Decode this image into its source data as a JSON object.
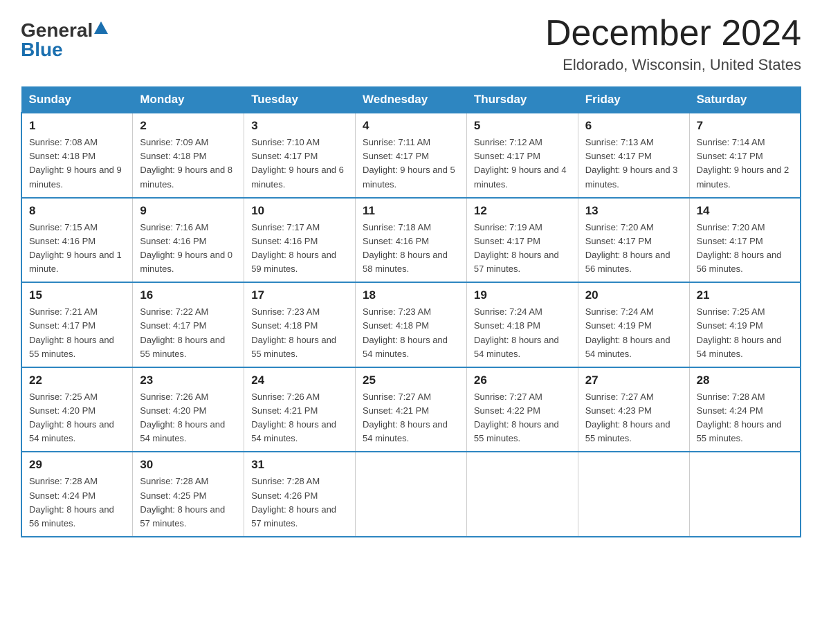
{
  "header": {
    "logo": {
      "general": "General",
      "blue": "Blue",
      "aria": "GeneralBlue logo"
    },
    "title": "December 2024",
    "location": "Eldorado, Wisconsin, United States"
  },
  "days_of_week": [
    "Sunday",
    "Monday",
    "Tuesday",
    "Wednesday",
    "Thursday",
    "Friday",
    "Saturday"
  ],
  "weeks": [
    [
      {
        "day": "1",
        "sunrise": "7:08 AM",
        "sunset": "4:18 PM",
        "daylight": "9 hours and 9 minutes."
      },
      {
        "day": "2",
        "sunrise": "7:09 AM",
        "sunset": "4:18 PM",
        "daylight": "9 hours and 8 minutes."
      },
      {
        "day": "3",
        "sunrise": "7:10 AM",
        "sunset": "4:17 PM",
        "daylight": "9 hours and 6 minutes."
      },
      {
        "day": "4",
        "sunrise": "7:11 AM",
        "sunset": "4:17 PM",
        "daylight": "9 hours and 5 minutes."
      },
      {
        "day": "5",
        "sunrise": "7:12 AM",
        "sunset": "4:17 PM",
        "daylight": "9 hours and 4 minutes."
      },
      {
        "day": "6",
        "sunrise": "7:13 AM",
        "sunset": "4:17 PM",
        "daylight": "9 hours and 3 minutes."
      },
      {
        "day": "7",
        "sunrise": "7:14 AM",
        "sunset": "4:17 PM",
        "daylight": "9 hours and 2 minutes."
      }
    ],
    [
      {
        "day": "8",
        "sunrise": "7:15 AM",
        "sunset": "4:16 PM",
        "daylight": "9 hours and 1 minute."
      },
      {
        "day": "9",
        "sunrise": "7:16 AM",
        "sunset": "4:16 PM",
        "daylight": "9 hours and 0 minutes."
      },
      {
        "day": "10",
        "sunrise": "7:17 AM",
        "sunset": "4:16 PM",
        "daylight": "8 hours and 59 minutes."
      },
      {
        "day": "11",
        "sunrise": "7:18 AM",
        "sunset": "4:16 PM",
        "daylight": "8 hours and 58 minutes."
      },
      {
        "day": "12",
        "sunrise": "7:19 AM",
        "sunset": "4:17 PM",
        "daylight": "8 hours and 57 minutes."
      },
      {
        "day": "13",
        "sunrise": "7:20 AM",
        "sunset": "4:17 PM",
        "daylight": "8 hours and 56 minutes."
      },
      {
        "day": "14",
        "sunrise": "7:20 AM",
        "sunset": "4:17 PM",
        "daylight": "8 hours and 56 minutes."
      }
    ],
    [
      {
        "day": "15",
        "sunrise": "7:21 AM",
        "sunset": "4:17 PM",
        "daylight": "8 hours and 55 minutes."
      },
      {
        "day": "16",
        "sunrise": "7:22 AM",
        "sunset": "4:17 PM",
        "daylight": "8 hours and 55 minutes."
      },
      {
        "day": "17",
        "sunrise": "7:23 AM",
        "sunset": "4:18 PM",
        "daylight": "8 hours and 55 minutes."
      },
      {
        "day": "18",
        "sunrise": "7:23 AM",
        "sunset": "4:18 PM",
        "daylight": "8 hours and 54 minutes."
      },
      {
        "day": "19",
        "sunrise": "7:24 AM",
        "sunset": "4:18 PM",
        "daylight": "8 hours and 54 minutes."
      },
      {
        "day": "20",
        "sunrise": "7:24 AM",
        "sunset": "4:19 PM",
        "daylight": "8 hours and 54 minutes."
      },
      {
        "day": "21",
        "sunrise": "7:25 AM",
        "sunset": "4:19 PM",
        "daylight": "8 hours and 54 minutes."
      }
    ],
    [
      {
        "day": "22",
        "sunrise": "7:25 AM",
        "sunset": "4:20 PM",
        "daylight": "8 hours and 54 minutes."
      },
      {
        "day": "23",
        "sunrise": "7:26 AM",
        "sunset": "4:20 PM",
        "daylight": "8 hours and 54 minutes."
      },
      {
        "day": "24",
        "sunrise": "7:26 AM",
        "sunset": "4:21 PM",
        "daylight": "8 hours and 54 minutes."
      },
      {
        "day": "25",
        "sunrise": "7:27 AM",
        "sunset": "4:21 PM",
        "daylight": "8 hours and 54 minutes."
      },
      {
        "day": "26",
        "sunrise": "7:27 AM",
        "sunset": "4:22 PM",
        "daylight": "8 hours and 55 minutes."
      },
      {
        "day": "27",
        "sunrise": "7:27 AM",
        "sunset": "4:23 PM",
        "daylight": "8 hours and 55 minutes."
      },
      {
        "day": "28",
        "sunrise": "7:28 AM",
        "sunset": "4:24 PM",
        "daylight": "8 hours and 55 minutes."
      }
    ],
    [
      {
        "day": "29",
        "sunrise": "7:28 AM",
        "sunset": "4:24 PM",
        "daylight": "8 hours and 56 minutes."
      },
      {
        "day": "30",
        "sunrise": "7:28 AM",
        "sunset": "4:25 PM",
        "daylight": "8 hours and 57 minutes."
      },
      {
        "day": "31",
        "sunrise": "7:28 AM",
        "sunset": "4:26 PM",
        "daylight": "8 hours and 57 minutes."
      },
      null,
      null,
      null,
      null
    ]
  ],
  "labels": {
    "sunrise": "Sunrise:",
    "sunset": "Sunset:",
    "daylight": "Daylight:"
  }
}
